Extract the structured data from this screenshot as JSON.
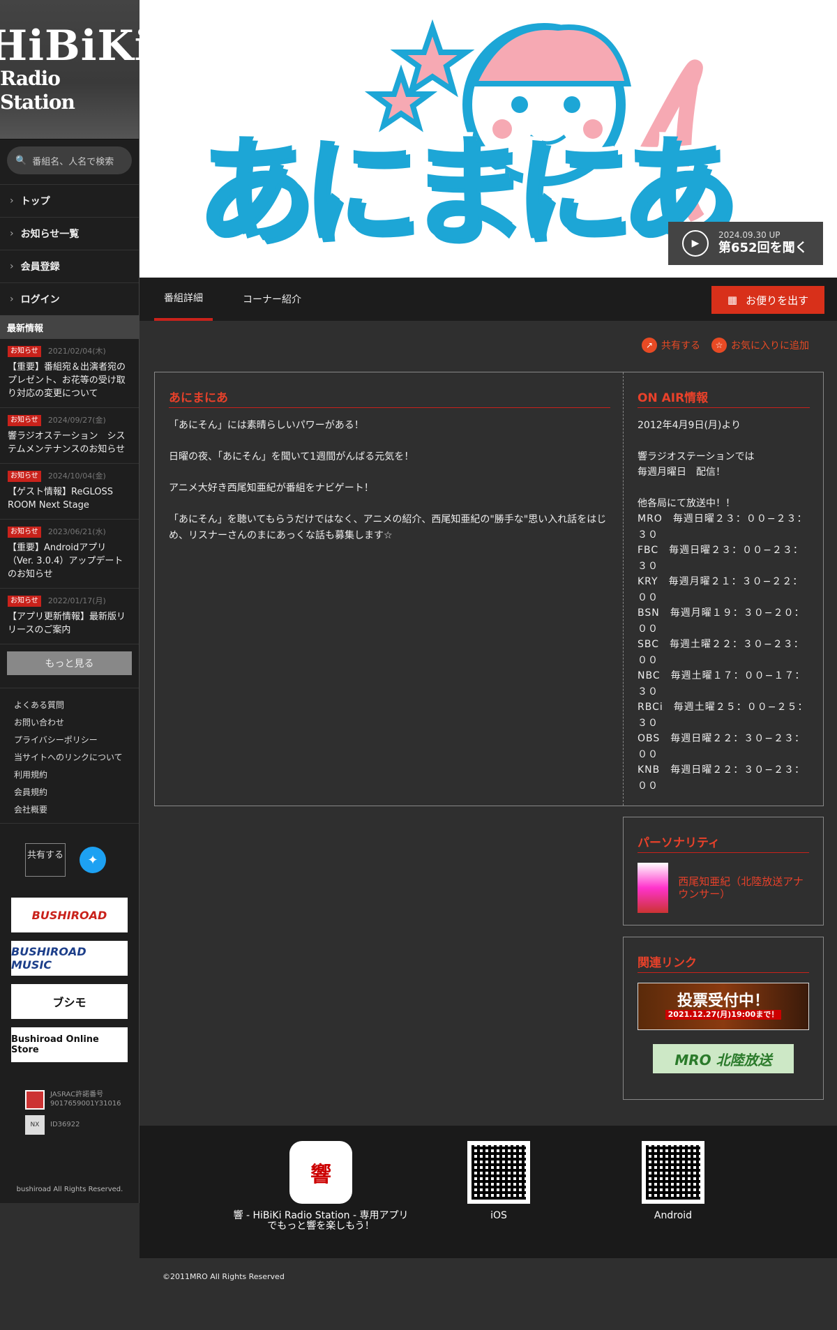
{
  "sidebar": {
    "logo_line1": "HiBiKi",
    "logo_line2": "Radio Station",
    "search_placeholder": "番組名、人名で検索",
    "nav": [
      "トップ",
      "お知らせ一覧",
      "会員登録",
      "ログイン"
    ],
    "news_heading": "最新情報",
    "news": [
      {
        "badge": "お知らせ",
        "date": "2021/02/04(木)",
        "text": "【重要】番組宛＆出演者宛のプレゼント、お花等の受け取り対応の変更について"
      },
      {
        "badge": "お知らせ",
        "date": "2024/09/27(金)",
        "text": "響ラジオステーション　システムメンテナンスのお知らせ"
      },
      {
        "badge": "お知らせ",
        "date": "2024/10/04(金)",
        "text": "【ゲスト情報】ReGLOSS ROOM Next Stage"
      },
      {
        "badge": "お知らせ",
        "date": "2023/06/21(水)",
        "text": "【重要】Androidアプリ（Ver. 3.0.4）アップデートのお知らせ"
      },
      {
        "badge": "お知らせ",
        "date": "2022/01/17(月)",
        "text": "【アプリ更新情報】最新版リリースのご案内"
      }
    ],
    "more": "もっと見る",
    "footer_links": [
      "よくある質問",
      "お問い合わせ",
      "プライバシーポリシー",
      "当サイトへのリンクについて",
      "利用規約",
      "会員規約",
      "会社概要"
    ],
    "share_label": "共有する",
    "sponsors": [
      "BUSHIROAD",
      "BUSHIROAD MUSIC",
      "ブシモ",
      "Bushiroad Online Store"
    ],
    "jasrac_label": "JASRAC許諾番号",
    "jasrac_number": "9017659001Y31016",
    "id_label": "ID36922",
    "copyright": " bushiroad All Rights Reserved."
  },
  "hero": {
    "title": "あにまにあ",
    "play_date": "2024.09.30 UP",
    "play_title": "第652回を聞く"
  },
  "tabs": [
    "番組詳細",
    "コーナー紹介"
  ],
  "letter_button": "お便りを出す",
  "actions": {
    "share": "共有する",
    "favorite": "お気に入りに追加"
  },
  "program": {
    "heading": "あにまにあ",
    "paragraphs": [
      "「あにそん」には素晴らしいパワーがある！",
      "日曜の夜、「あにそん」を聞いて1週間がんばる元気を！",
      "アニメ大好き西尾知亜紀が番組をナビゲート！",
      "「あにそん」を聴いてもらうだけではなく、アニメの紹介、西尾知亜紀の\"勝手な\"思い入れ話をはじめ、リスナーさんのまにあっくな話も募集します☆"
    ]
  },
  "onair": {
    "heading": "ON AIR情報",
    "since": "2012年4月9日(月)より",
    "line1": "響ラジオステーションでは",
    "line2": "毎週月曜日　配信！",
    "other": "他各局にて放送中！！",
    "stations": [
      "MRO　毎週日曜２３：００−２３：３０",
      "FBC　毎週日曜２３：００−２３：３０",
      "KRY　毎週月曜２１：３０−２２：００",
      "BSN　毎週月曜１９：３０−２０：００",
      "SBC　毎週土曜２２：３０−２３：００",
      "NBC　毎週土曜１７：００−１７：３０",
      "RBCi　毎週土曜２５：００−２５：３０",
      "OBS　毎週日曜２２：３０−２３：００",
      "KNB　毎週日曜２２：３０−２３：００"
    ]
  },
  "personality": {
    "heading": "パーソナリティ",
    "name": "西尾知亜紀（北陸放送アナウンサー）"
  },
  "links": {
    "heading": "関連リンク",
    "banner1": "投票受付中！",
    "banner1_sub": "2021.12.27(月)19:00まで！",
    "banner2": "MRO 北陸放送"
  },
  "footer": {
    "app_label": "響 - HiBiKi Radio Station - 専用アプリでもっと響を楽しもう！",
    "ios": " iOS",
    "android": " Android",
    "copyright": "©2011MRO All Rights Reserved"
  },
  "colors": {
    "accent": "#e8412a",
    "button": "#d8301a",
    "sidebar": "#1e1e1e"
  }
}
